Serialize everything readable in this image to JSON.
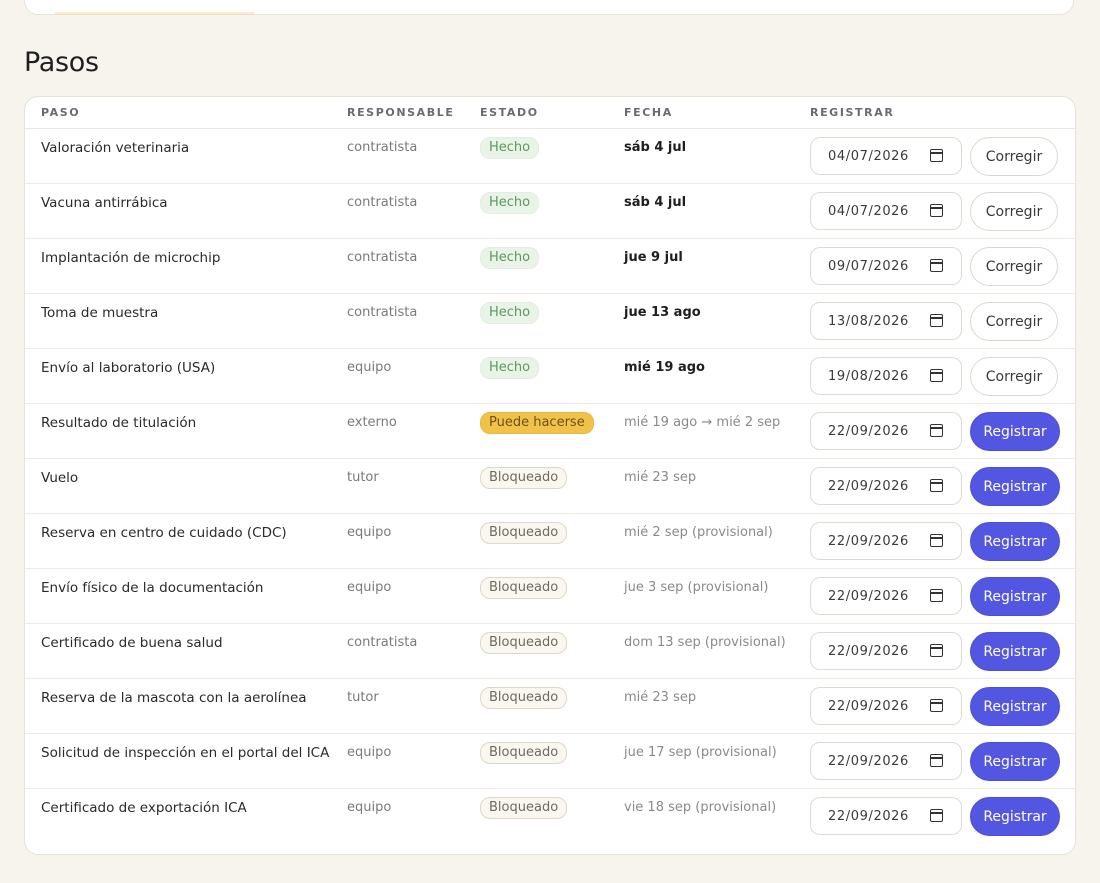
{
  "section": {
    "title": "Pasos"
  },
  "table": {
    "headers": {
      "paso": "PASO",
      "responsable": "RESPONSABLE",
      "estado": "ESTADO",
      "fecha": "FECHA",
      "registrar": "REGISTRAR"
    },
    "rows": [
      {
        "paso": "Valoración veterinaria",
        "responsable": "contratista",
        "estado": "Hecho",
        "fecha": "sáb 4 jul",
        "fecha_input": "04/07/2026",
        "action": "Corregir"
      },
      {
        "paso": "Vacuna antirrábica",
        "responsable": "contratista",
        "estado": "Hecho",
        "fecha": "sáb 4 jul",
        "fecha_input": "04/07/2026",
        "action": "Corregir"
      },
      {
        "paso": "Implantación de microchip",
        "responsable": "contratista",
        "estado": "Hecho",
        "fecha": "jue 9 jul",
        "fecha_input": "09/07/2026",
        "action": "Corregir"
      },
      {
        "paso": "Toma de muestra",
        "responsable": "contratista",
        "estado": "Hecho",
        "fecha": "jue 13 ago",
        "fecha_input": "13/08/2026",
        "action": "Corregir"
      },
      {
        "paso": "Envío al laboratorio (USA)",
        "responsable": "equipo",
        "estado": "Hecho",
        "fecha": "mié 19 ago",
        "fecha_input": "19/08/2026",
        "action": "Corregir"
      },
      {
        "paso": "Resultado de titulación",
        "responsable": "externo",
        "estado": "Puede hacerse",
        "fecha": "mié 19 ago → mié 2 sep",
        "fecha_input": "22/09/2026",
        "action": "Registrar"
      },
      {
        "paso": "Vuelo",
        "responsable": "tutor",
        "estado": "Bloqueado",
        "fecha": "mié 23 sep",
        "fecha_input": "22/09/2026",
        "action": "Registrar"
      },
      {
        "paso": "Reserva en centro de cuidado (CDC)",
        "responsable": "equipo",
        "estado": "Bloqueado",
        "fecha": "mié 2 sep (provisional)",
        "fecha_input": "22/09/2026",
        "action": "Registrar"
      },
      {
        "paso": "Envío físico de la documentación",
        "responsable": "equipo",
        "estado": "Bloqueado",
        "fecha": "jue 3 sep (provisional)",
        "fecha_input": "22/09/2026",
        "action": "Registrar"
      },
      {
        "paso": "Certificado de buena salud",
        "responsable": "contratista",
        "estado": "Bloqueado",
        "fecha": "dom 13 sep (provisional)",
        "fecha_input": "22/09/2026",
        "action": "Registrar"
      },
      {
        "paso": "Reserva de la mascota con la aerolínea",
        "responsable": "tutor",
        "estado": "Bloqueado",
        "fecha": "mié 23 sep",
        "fecha_input": "22/09/2026",
        "action": "Registrar"
      },
      {
        "paso": "Solicitud de inspección en el portal del ICA",
        "responsable": "equipo",
        "estado": "Bloqueado",
        "fecha": "jue 17 sep (provisional)",
        "fecha_input": "22/09/2026",
        "action": "Registrar"
      },
      {
        "paso": "Certificado de exportación ICA",
        "responsable": "equipo",
        "estado": "Bloqueado",
        "fecha": "vie 18 sep (provisional)",
        "fecha_input": "22/09/2026",
        "action": "Registrar"
      }
    ]
  },
  "colors": {
    "accent": "#5256e0",
    "done": "#5a9a5c",
    "ready": "#f0c24b",
    "background": "#f7f4ed"
  },
  "icons": {
    "date_picker": "calendar-icon"
  }
}
